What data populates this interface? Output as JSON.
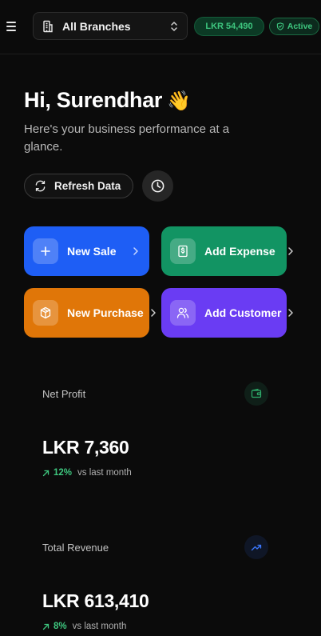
{
  "header": {
    "branch_label": "All Branches",
    "balance": "LKR 54,490",
    "status": "Active"
  },
  "greeting": {
    "title": "Hi, Surendhar",
    "emoji": "👋",
    "subtitle": "Here's your business performance at a glance."
  },
  "toolbar": {
    "refresh_label": "Refresh Data"
  },
  "actions": [
    {
      "label": "New Sale",
      "color": "#1e5ef5"
    },
    {
      "label": "Add Expense",
      "color": "#129463"
    },
    {
      "label": "New Purchase",
      "color": "#e07608"
    },
    {
      "label": "Add Customer",
      "color": "#6a3cf3"
    }
  ],
  "stats": [
    {
      "title": "Net Profit",
      "value": "LKR 7,360",
      "change": "12%",
      "compare": "vs last month",
      "icon": "wallet-icon"
    },
    {
      "title": "Total Revenue",
      "value": "LKR 613,410",
      "change": "8%",
      "compare": "vs last month",
      "icon": "trending-up-icon"
    }
  ],
  "colors": {
    "background": "#0b0b0b",
    "positive": "#3ec77f"
  }
}
